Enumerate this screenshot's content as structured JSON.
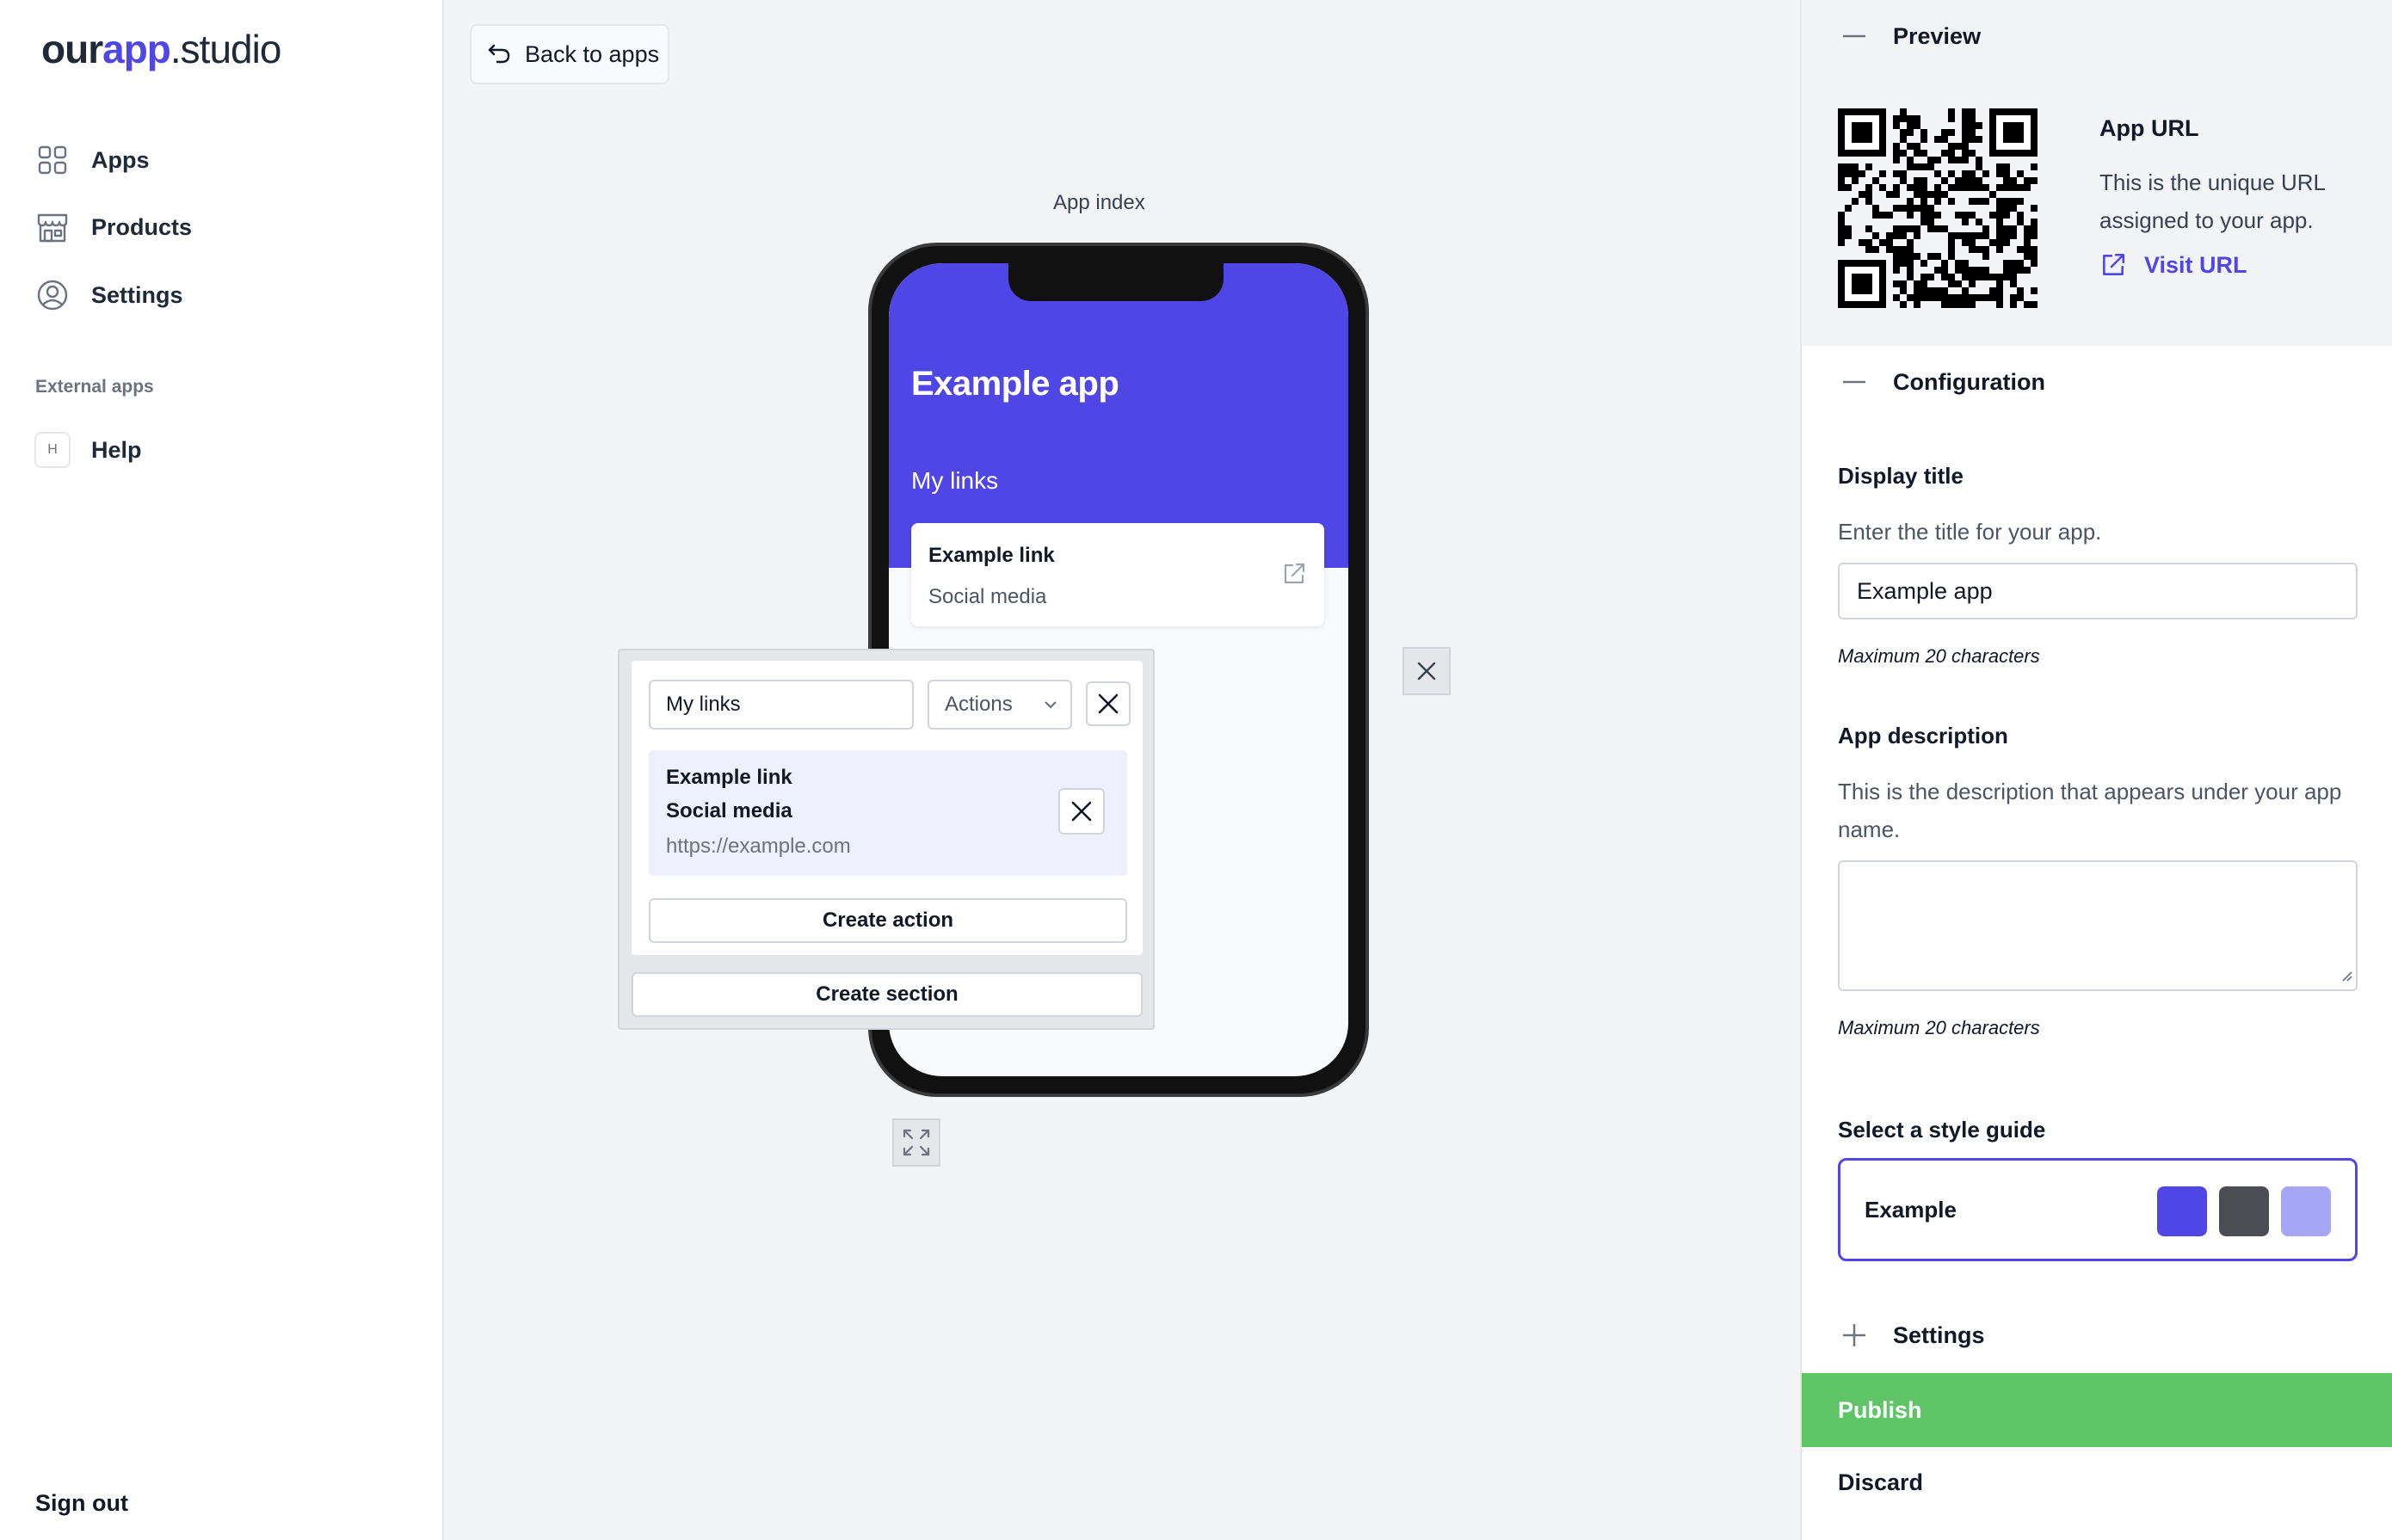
{
  "brand": {
    "part1": "our",
    "part2": "app",
    "part3": ".studio",
    "accent": "#4f46e5"
  },
  "sidebar": {
    "items": [
      {
        "label": "Apps",
        "icon": "grid-icon"
      },
      {
        "label": "Products",
        "icon": "store-icon"
      },
      {
        "label": "Settings",
        "icon": "user-circle-icon"
      }
    ],
    "external_title": "External apps",
    "external_items": [
      {
        "label": "Help",
        "badge": "H"
      }
    ],
    "sign_out": "Sign out"
  },
  "canvas": {
    "back_label": "Back to apps",
    "page_label": "App index",
    "phone": {
      "app_title": "Example app",
      "section_title": "My links",
      "link": {
        "title": "Example link",
        "subtitle": "Social media"
      },
      "header_color": "#4f46e5"
    },
    "editor": {
      "section_name": "My links",
      "actions_label": "Actions",
      "action": {
        "title": "Example link",
        "subtitle": "Social media",
        "url": "https://example.com"
      },
      "create_action": "Create action",
      "create_section": "Create section"
    }
  },
  "panel": {
    "preview": {
      "heading": "Preview",
      "url_title": "App URL",
      "url_desc": "This is the unique URL assigned to your app.",
      "visit_label": "Visit URL"
    },
    "configuration": {
      "heading": "Configuration",
      "display_title": {
        "label": "Display title",
        "help": "Enter the title for your app.",
        "value": "Example app",
        "note": "Maximum 20 characters"
      },
      "description": {
        "label": "App description",
        "help": "This is the description that appears under your app name.",
        "value": "",
        "note": "Maximum 20 characters"
      },
      "style_guide": {
        "label": "Select a style guide",
        "name": "Example",
        "colors": [
          "#4f46e5",
          "#4b4d52",
          "#a5a6f6"
        ]
      }
    },
    "settings_heading": "Settings",
    "publish": "Publish",
    "publish_color": "#5ec466",
    "discard": "Discard"
  }
}
